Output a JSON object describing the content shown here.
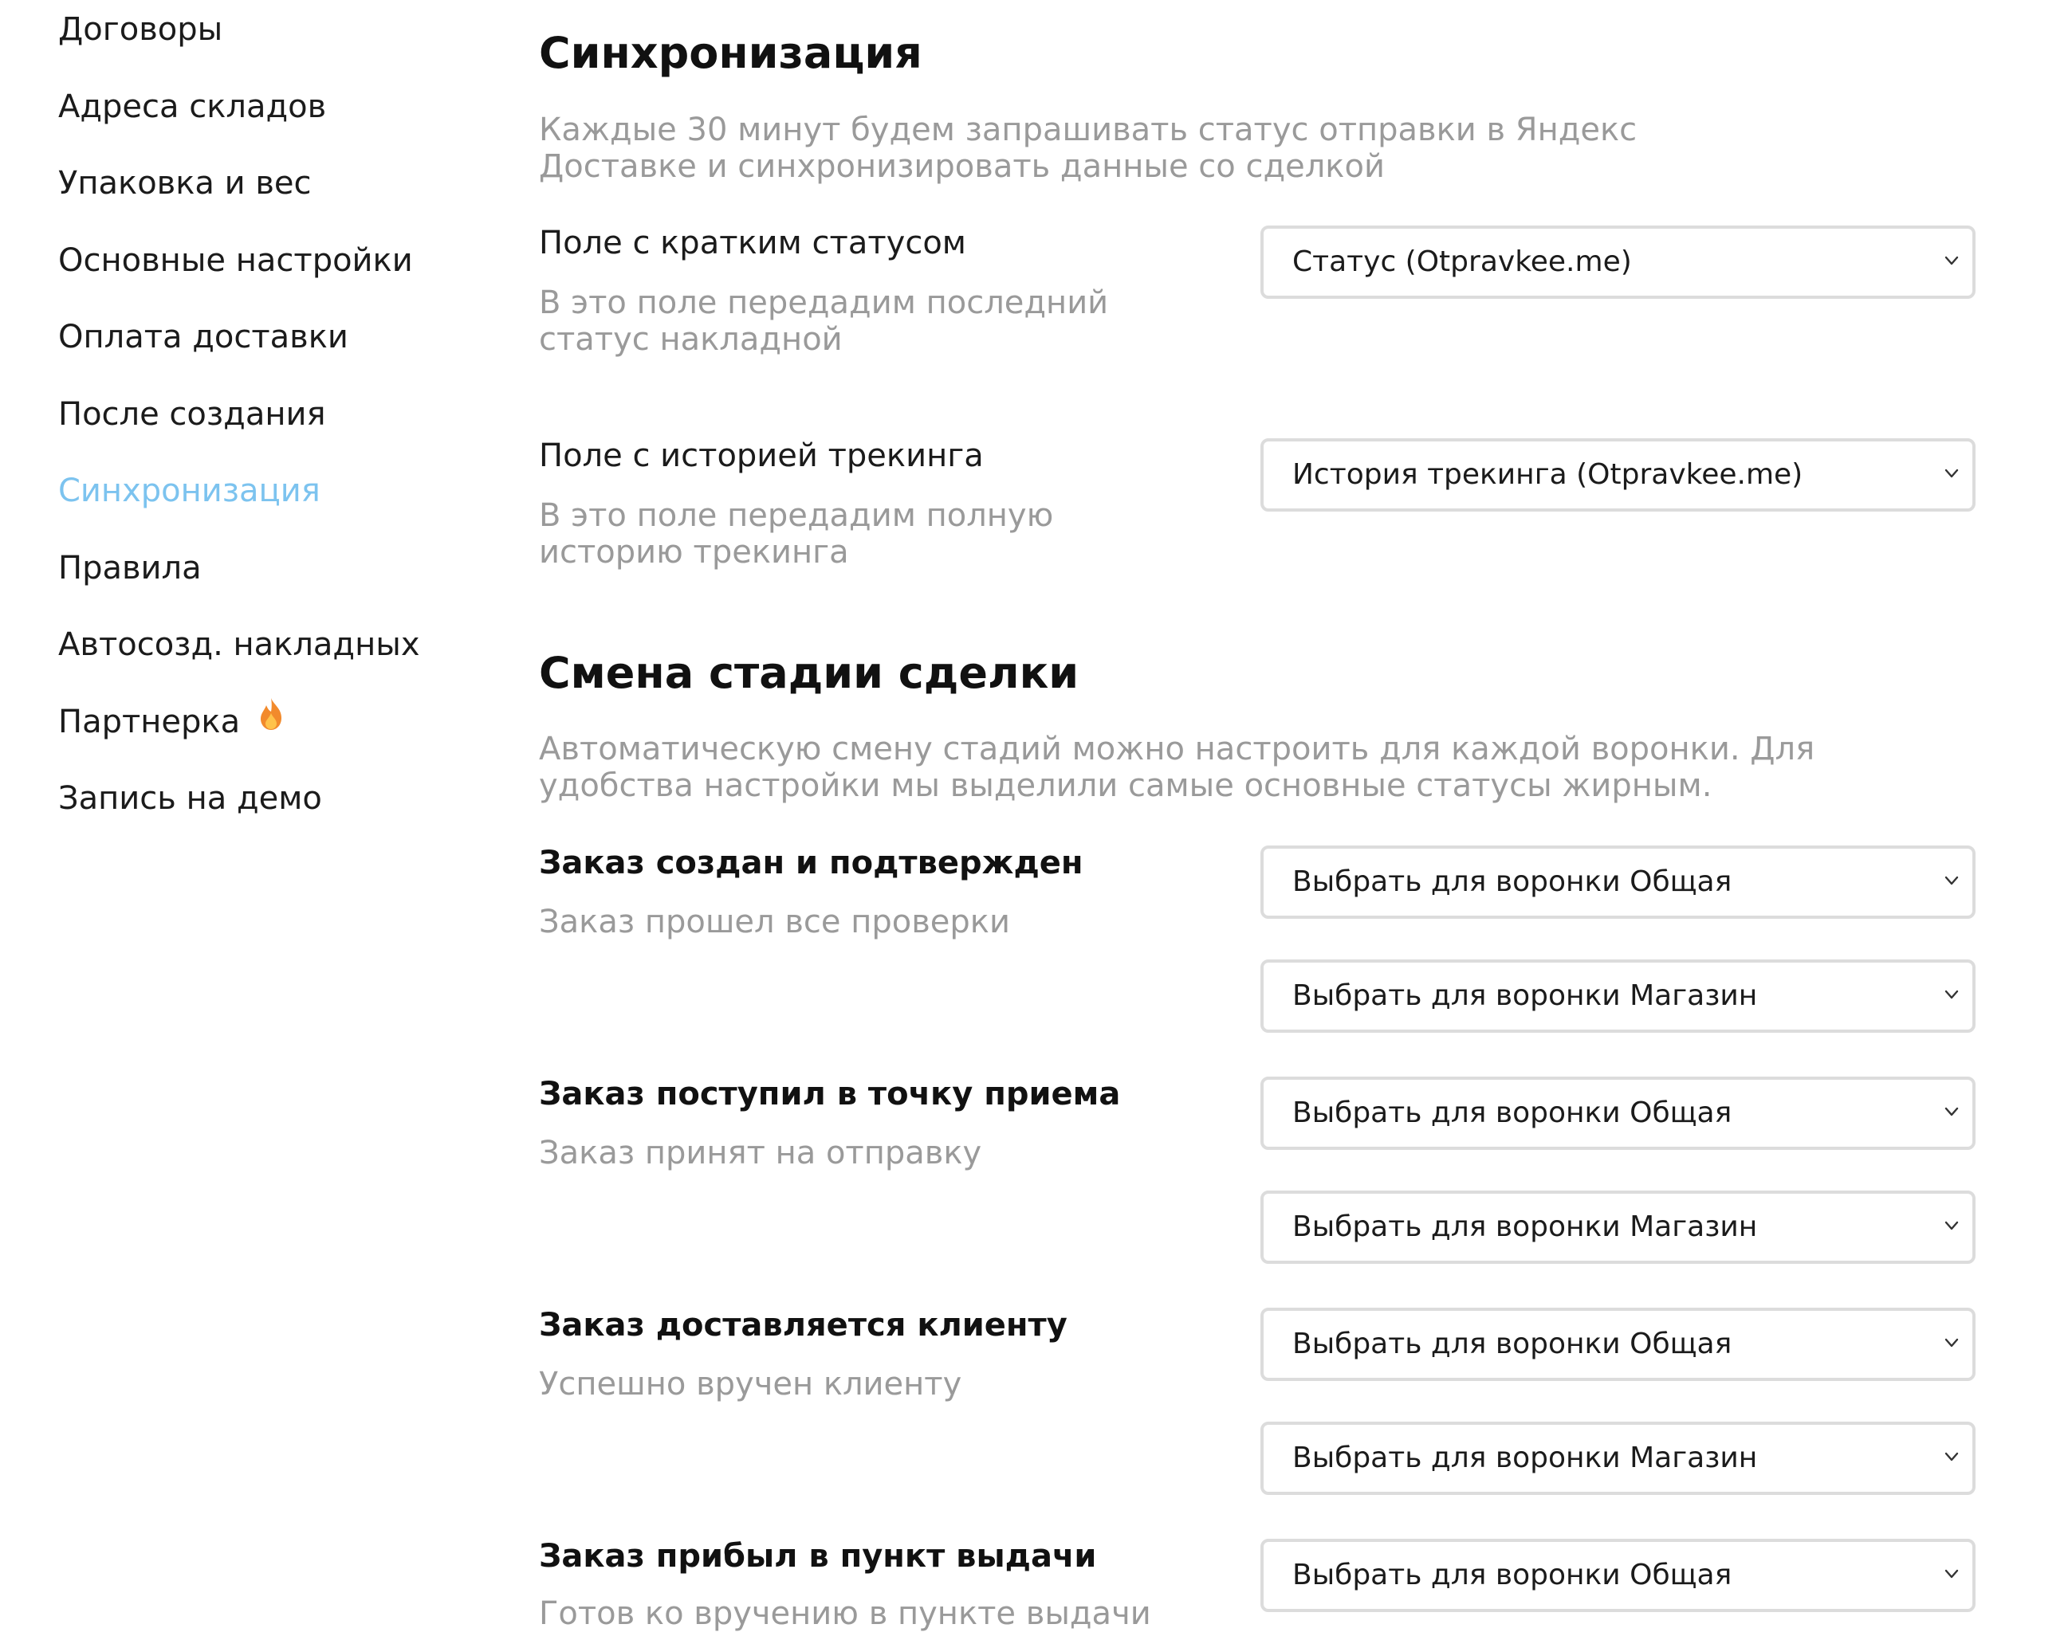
{
  "sidebar": {
    "items": [
      {
        "label": "Договоры"
      },
      {
        "label": "Адреса складов"
      },
      {
        "label": "Упаковка и вес"
      },
      {
        "label": "Основные настройки"
      },
      {
        "label": "Оплата доставки"
      },
      {
        "label": "После создания"
      },
      {
        "label": "Синхронизация",
        "active": true
      },
      {
        "label": "Правила"
      },
      {
        "label": "Автосозд. накладных"
      },
      {
        "label": "Партнерка",
        "icon": "fire-icon"
      },
      {
        "label": "Запись на демо"
      }
    ]
  },
  "sync": {
    "title": "Синхронизация",
    "description": "Каждые 30 минут будем запрашивать статус отправки в Яндекс Доставке и синхронизировать данные со сделкой",
    "fields": [
      {
        "label": "Поле с кратким статусом",
        "hint": "В это поле передадим последний статус накладной",
        "value": "Статус (Otpravkee.me)"
      },
      {
        "label": "Поле с историей трекинга",
        "hint": "В это поле передадим полную историю трекинга",
        "value": "История трекинга (Otpravkee.me)"
      }
    ]
  },
  "stage": {
    "title": "Смена стадии сделки",
    "description": "Автоматическую смену стадий можно настроить для каждой воронки. Для удобства настройки мы выделили самые основные статусы жирным.",
    "statuses": [
      {
        "label": "Заказ создан и подтвержден",
        "hint": "Заказ прошел все проверки",
        "selects": [
          "Выбрать для воронки Общая",
          "Выбрать для воронки Магазин"
        ]
      },
      {
        "label": "Заказ поступил в точку приема",
        "hint": "Заказ принят на отправку",
        "selects": [
          "Выбрать для воронки Общая",
          "Выбрать для воронки Магазин"
        ]
      },
      {
        "label": "Заказ доставляется клиенту",
        "hint": "Успешно вручен клиенту",
        "selects": [
          "Выбрать для воронки Общая",
          "Выбрать для воронки Магазин"
        ]
      },
      {
        "label": "Заказ прибыл в пункт выдачи",
        "hint": "Готов ко вручению в пункте выдачи",
        "selects": [
          "Выбрать для воронки Общая"
        ]
      }
    ]
  },
  "colors": {
    "active_nav": "#7cc3ef",
    "muted_text": "#9a9a9a",
    "select_border": "#dcdcdc"
  }
}
